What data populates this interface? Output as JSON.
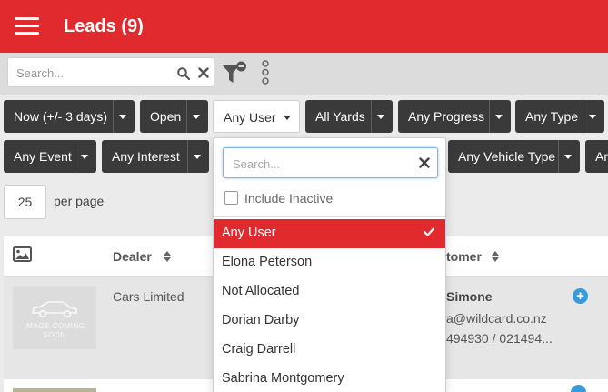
{
  "header": {
    "title": "Leads (9)"
  },
  "search": {
    "placeholder": "Search..."
  },
  "filters": {
    "row1": [
      "Now (+/- 3 days)",
      "Open",
      "Any User",
      "All Yards",
      "Any Progress",
      "Any Type"
    ],
    "row2": [
      "Any Event",
      "Any Interest",
      "Any Vehicle Type",
      "An"
    ]
  },
  "pagination": {
    "per_page_value": "25",
    "per_page_label": "per page"
  },
  "table": {
    "columns": {
      "dealer": "Dealer",
      "customer": "tomer"
    },
    "rows": [
      {
        "image_text_1": "IMAGE COMING",
        "image_text_2": "SOON",
        "dealer": "Cars Limited",
        "customer_name": "Simone",
        "customer_email": "a@wildcard.co.nz",
        "customer_phone": "494930 / 021494..."
      }
    ]
  },
  "user_dropdown": {
    "search_placeholder": "Search...",
    "include_inactive_label": "Include Inactive",
    "include_inactive_checked": false,
    "selected": "Any User",
    "options": [
      "Any User",
      "Elona Peterson",
      "Not Allocated",
      "Dorian Darby",
      "Craig Darrell",
      "Sabrina Montgomery"
    ]
  },
  "colors": {
    "brand_red": "#e12a2e",
    "filter_button_bg": "#3a3a3a",
    "accent_blue": "#3a9ad9"
  }
}
